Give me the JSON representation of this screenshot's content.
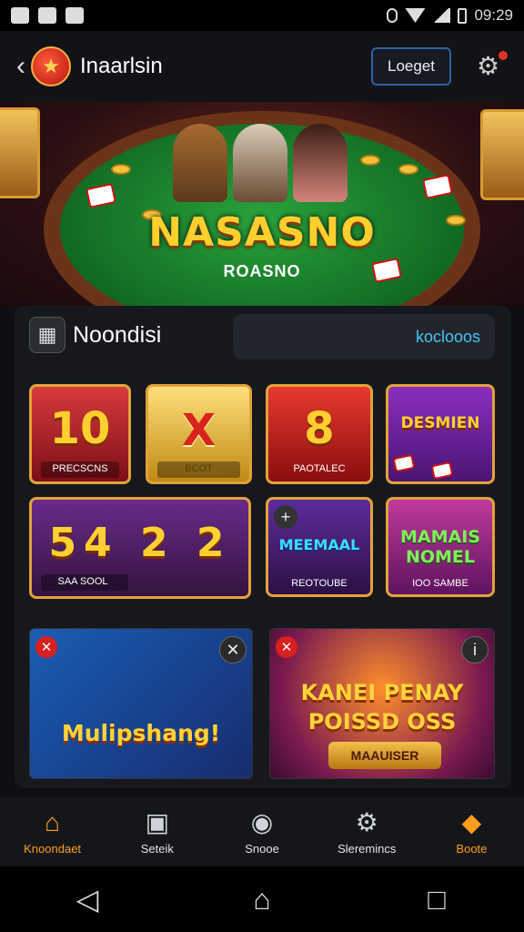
{
  "status_bar": {
    "time": "09:29"
  },
  "header": {
    "title": "Inaarlsin",
    "login_label": "Loeget"
  },
  "hero": {
    "title": "NASASNO",
    "subtitle": "ROASNO"
  },
  "section": {
    "title": "Noondisi",
    "more_label": "koclooos",
    "tiles": [
      {
        "big": "10",
        "label": "PRECSCNS"
      },
      {
        "big": "X",
        "label": "BCOT"
      },
      {
        "big": "8",
        "label": "PAOTALEC"
      },
      {
        "big": "DESMIEN",
        "label": ""
      },
      {
        "big": "54 2 2",
        "label": "SAA SOOL"
      },
      {
        "big": "MEEMAAL",
        "label": "REOTOUBE"
      },
      {
        "big": "MAMAIS NOMEL",
        "label": "IOO SAMBE"
      }
    ],
    "banners": [
      {
        "title": "Mulipshang!"
      },
      {
        "title": "KANEI PENAY POISSD OSS",
        "button": "MAAUISER"
      }
    ]
  },
  "bottom_nav": [
    {
      "label": "Knoondaet",
      "icon": "home-icon"
    },
    {
      "label": "Seteik",
      "icon": "card-icon"
    },
    {
      "label": "Snooe",
      "icon": "gamepad-icon"
    },
    {
      "label": "Sleremincs",
      "icon": "settings-icon"
    },
    {
      "label": "Boote",
      "icon": "shield-icon"
    }
  ],
  "colors": {
    "accent": "#ff9c1a",
    "link": "#46c6f1",
    "gold": "#ffd02f"
  }
}
